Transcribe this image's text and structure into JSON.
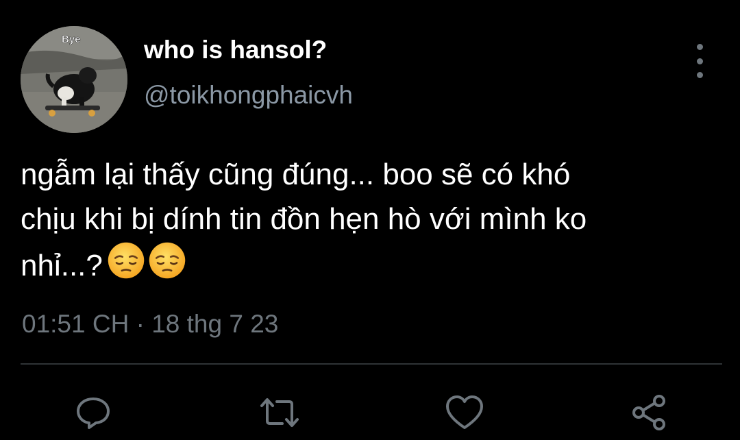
{
  "author": {
    "display_name": "who is hansol?",
    "handle": "@toikhongphaicvh",
    "avatar_caption": "Bye"
  },
  "tweet": {
    "text_lines": [
      "ngẫm lại thấy cũng đúng... boo sẽ có khó",
      "chịu khi bị dính tin đồn hẹn hò với mình ko",
      "nhỉ...?"
    ],
    "emojis": [
      "pensive-face",
      "pensive-face"
    ],
    "timestamp": "01:51 CH · 18 thg 7 23"
  },
  "actions": {
    "icons": [
      "reply-icon",
      "retweet-icon",
      "like-icon",
      "share-icon"
    ]
  },
  "colors": {
    "background": "#000000",
    "primary_text": "#ffffff",
    "secondary_text": "#8b98a5",
    "muted_text": "#6e767d",
    "divider": "#2f3336",
    "icon": "#6e767d"
  }
}
